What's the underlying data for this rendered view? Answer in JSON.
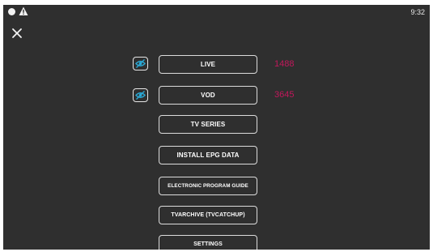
{
  "status_bar": {
    "time": "9:32",
    "icons": [
      "circle-icon",
      "warning-icon"
    ]
  },
  "header": {
    "close_icon": "close-icon"
  },
  "menu": {
    "items": [
      {
        "label": "LIVE",
        "count": "1488",
        "toggle_icon": "eye-off-icon"
      },
      {
        "label": "VOD",
        "count": "3645",
        "toggle_icon": "eye-off-icon"
      },
      {
        "label": "TV SERIES"
      },
      {
        "label": "INSTALL EPG DATA"
      },
      {
        "label": "ELECTRONIC PROGRAM GUIDE"
      },
      {
        "label": "TVARCHIVE (TVCATCHUP)"
      },
      {
        "label": "SETTINGS"
      }
    ]
  },
  "colors": {
    "background": "#2f2f2f",
    "count": "#c2185b",
    "toggle_icon": "#29a9d6",
    "button_border": "#dcdcdc"
  }
}
